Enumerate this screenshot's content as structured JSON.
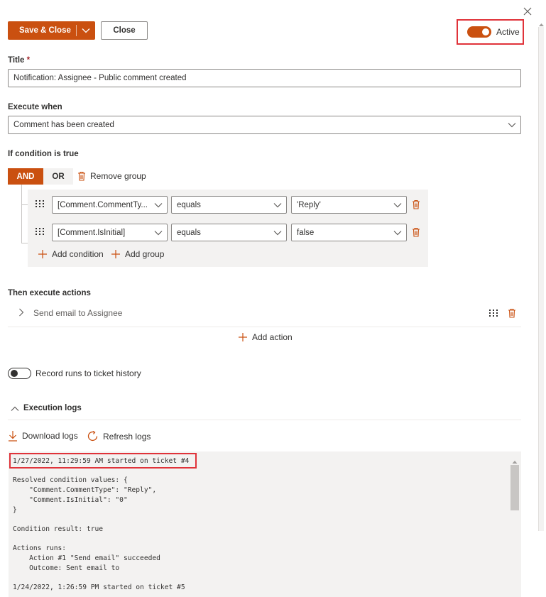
{
  "toolbar": {
    "save_close_label": "Save & Close",
    "close_label": "Close",
    "active_label": "Active",
    "active_on": true
  },
  "title_field": {
    "label": "Title",
    "required_mark": "*",
    "value": "Notification: Assignee - Public comment created"
  },
  "execute_when": {
    "label": "Execute when",
    "value": "Comment has been created"
  },
  "condition": {
    "label": "If condition is true",
    "and_label": "AND",
    "or_label": "OR",
    "remove_group_label": "Remove group",
    "rows": [
      {
        "field": "[Comment.CommentTy...",
        "operator": "equals",
        "value": "'Reply'"
      },
      {
        "field": "[Comment.IsInitial]",
        "operator": "equals",
        "value": "false"
      }
    ],
    "add_condition_label": "Add condition",
    "add_group_label": "Add group"
  },
  "actions": {
    "label": "Then execute actions",
    "items": [
      {
        "label": "Send email to Assignee"
      }
    ],
    "add_action_label": "Add action"
  },
  "record_runs": {
    "label": "Record runs to ticket history",
    "on": false
  },
  "execution_logs": {
    "label": "Execution logs",
    "download_label": "Download logs",
    "refresh_label": "Refresh logs",
    "lines": [
      "1/27/2022, 11:29:59 AM started on ticket #4",
      "",
      "Resolved condition values: {",
      "    \"Comment.CommentType\": \"Reply\",",
      "    \"Comment.IsInitial\": \"0\"",
      "}",
      "",
      "Condition result: true",
      "",
      "Actions runs:",
      "    Action #1 \"Send email\" succeeded",
      "    Outcome: Sent email to",
      "",
      "1/24/2022, 1:26:59 PM started on ticket #5"
    ]
  },
  "colors": {
    "accent": "#ca5010",
    "highlight_border": "#e0333a",
    "panel_bg": "#f3f2f1"
  }
}
